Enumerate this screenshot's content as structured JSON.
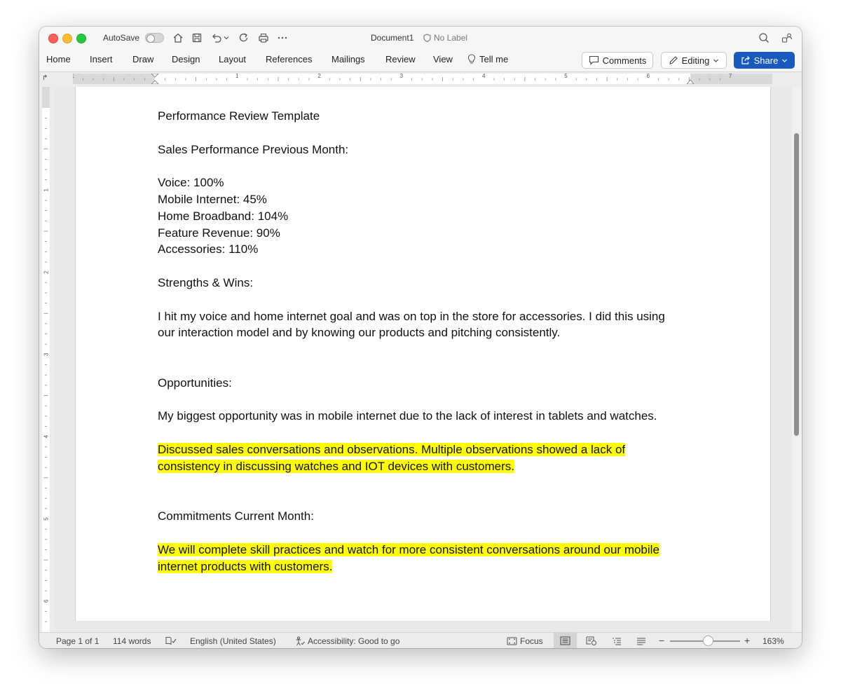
{
  "titlebar": {
    "autosave_label": "AutoSave",
    "document_title": "Document1",
    "sensitivity_label": "No Label"
  },
  "ribbon": {
    "tabs": [
      "Home",
      "Insert",
      "Draw",
      "Design",
      "Layout",
      "References",
      "Mailings",
      "Review",
      "View",
      "Tell me"
    ],
    "comments_label": "Comments",
    "editing_label": "Editing",
    "share_label": "Share",
    "share_color": "#185abd"
  },
  "ruler": {
    "numbers": [
      "1",
      "1",
      "2",
      "3",
      "4",
      "5",
      "6",
      "7"
    ]
  },
  "vertical_ruler": {
    "numbers": [
      "1",
      "2",
      "3",
      "4",
      "5",
      "6"
    ]
  },
  "document": {
    "lines": [
      "Performance Review Template",
      "Sales Performance Previous Month:",
      "Voice: 100%",
      "Mobile Internet: 45%",
      "Home Broadband: 104%",
      "Feature Revenue: 90%",
      "Accessories: 110%",
      "Strengths & Wins:",
      "I hit my voice and home internet goal and was on top in the store for accessories. I did this using our interaction model and by knowing our products and pitching consistently.",
      "Opportunities:",
      "My biggest opportunity was in mobile internet due to the lack of interest in tablets and watches.",
      "Discussed sales conversations and observations. Multiple observations showed a lack of consistency in discussing watches and IOT devices with customers.",
      "Commitments Current Month:",
      "We will complete skill practices and watch for more consistent conversations around our mobile internet products with customers."
    ],
    "highlight_color": "#ffff00"
  },
  "statusbar": {
    "page": "Page 1 of 1",
    "words": "114 words",
    "language": "English (United States)",
    "accessibility": "Accessibility: Good to go",
    "focus": "Focus",
    "zoom": "163%"
  },
  "icons": {
    "titlebar": [
      "home-icon",
      "save-icon",
      "undo-icon",
      "redo-icon",
      "print-icon",
      "more-icon",
      "search-icon",
      "collaborate-icon"
    ],
    "statusbar": [
      "proofing-icon",
      "accessibility-icon",
      "focus-icon",
      "print-layout-icon",
      "web-layout-icon",
      "outline-icon",
      "draft-icon"
    ]
  }
}
